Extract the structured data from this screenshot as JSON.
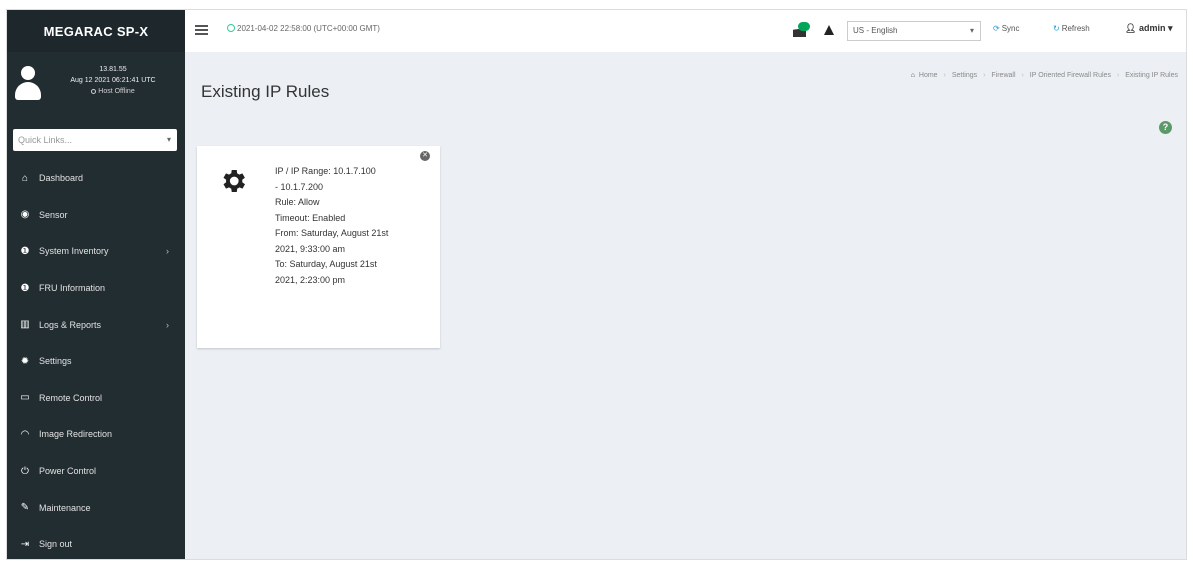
{
  "sidebar": {
    "brand": "MEGARAC SP-X",
    "user": {
      "ip": "13.81.55",
      "login_time": "Aug 12 2021 06:21:41 UTC",
      "host_status": "Host Offline"
    },
    "quick_links_placeholder": "Quick Links...",
    "items": [
      {
        "label": "Dashboard",
        "icon": "dashboard-icon"
      },
      {
        "label": "Sensor",
        "icon": "sensor-icon"
      },
      {
        "label": "System Inventory",
        "icon": "info-icon",
        "has_submenu": true
      },
      {
        "label": "FRU Information",
        "icon": "info-icon"
      },
      {
        "label": "Logs & Reports",
        "icon": "chart-icon",
        "has_submenu": true
      },
      {
        "label": "Settings",
        "icon": "gear-icon"
      },
      {
        "label": "Remote Control",
        "icon": "monitor-icon"
      },
      {
        "label": "Image Redirection",
        "icon": "disk-icon"
      },
      {
        "label": "Power Control",
        "icon": "power-icon"
      },
      {
        "label": "Maintenance",
        "icon": "wrench-icon"
      },
      {
        "label": "Sign out",
        "icon": "signout-icon"
      }
    ]
  },
  "header": {
    "datetime": "2021-04-02 22:58:00 (UTC+00:00 GMT)",
    "language": "US - English",
    "sync_label": "Sync",
    "refresh_label": "Refresh",
    "user_label": "admin"
  },
  "page": {
    "title": "Existing IP Rules",
    "breadcrumb": [
      "Home",
      "Settings",
      "Firewall",
      "IP Oriented Firewall Rules",
      "Existing IP Rules"
    ]
  },
  "rule_card": {
    "range_line1": "IP / IP Range: 10.1.7.100",
    "range_line2": "- 10.1.7.200",
    "rule": "Rule: Allow",
    "timeout": "Timeout: Enabled",
    "from_line1": "From: Saturday, August 21st",
    "from_line2": "2021, 9:33:00 am",
    "to_line1": "To: Saturday, August 21st",
    "to_line2": "2021, 2:23:00 pm"
  },
  "colors": {
    "sidebar_bg": "#222d32",
    "content_bg": "#ecf0f5",
    "accent": "#1f9fd5",
    "badge": "#00a65a"
  }
}
